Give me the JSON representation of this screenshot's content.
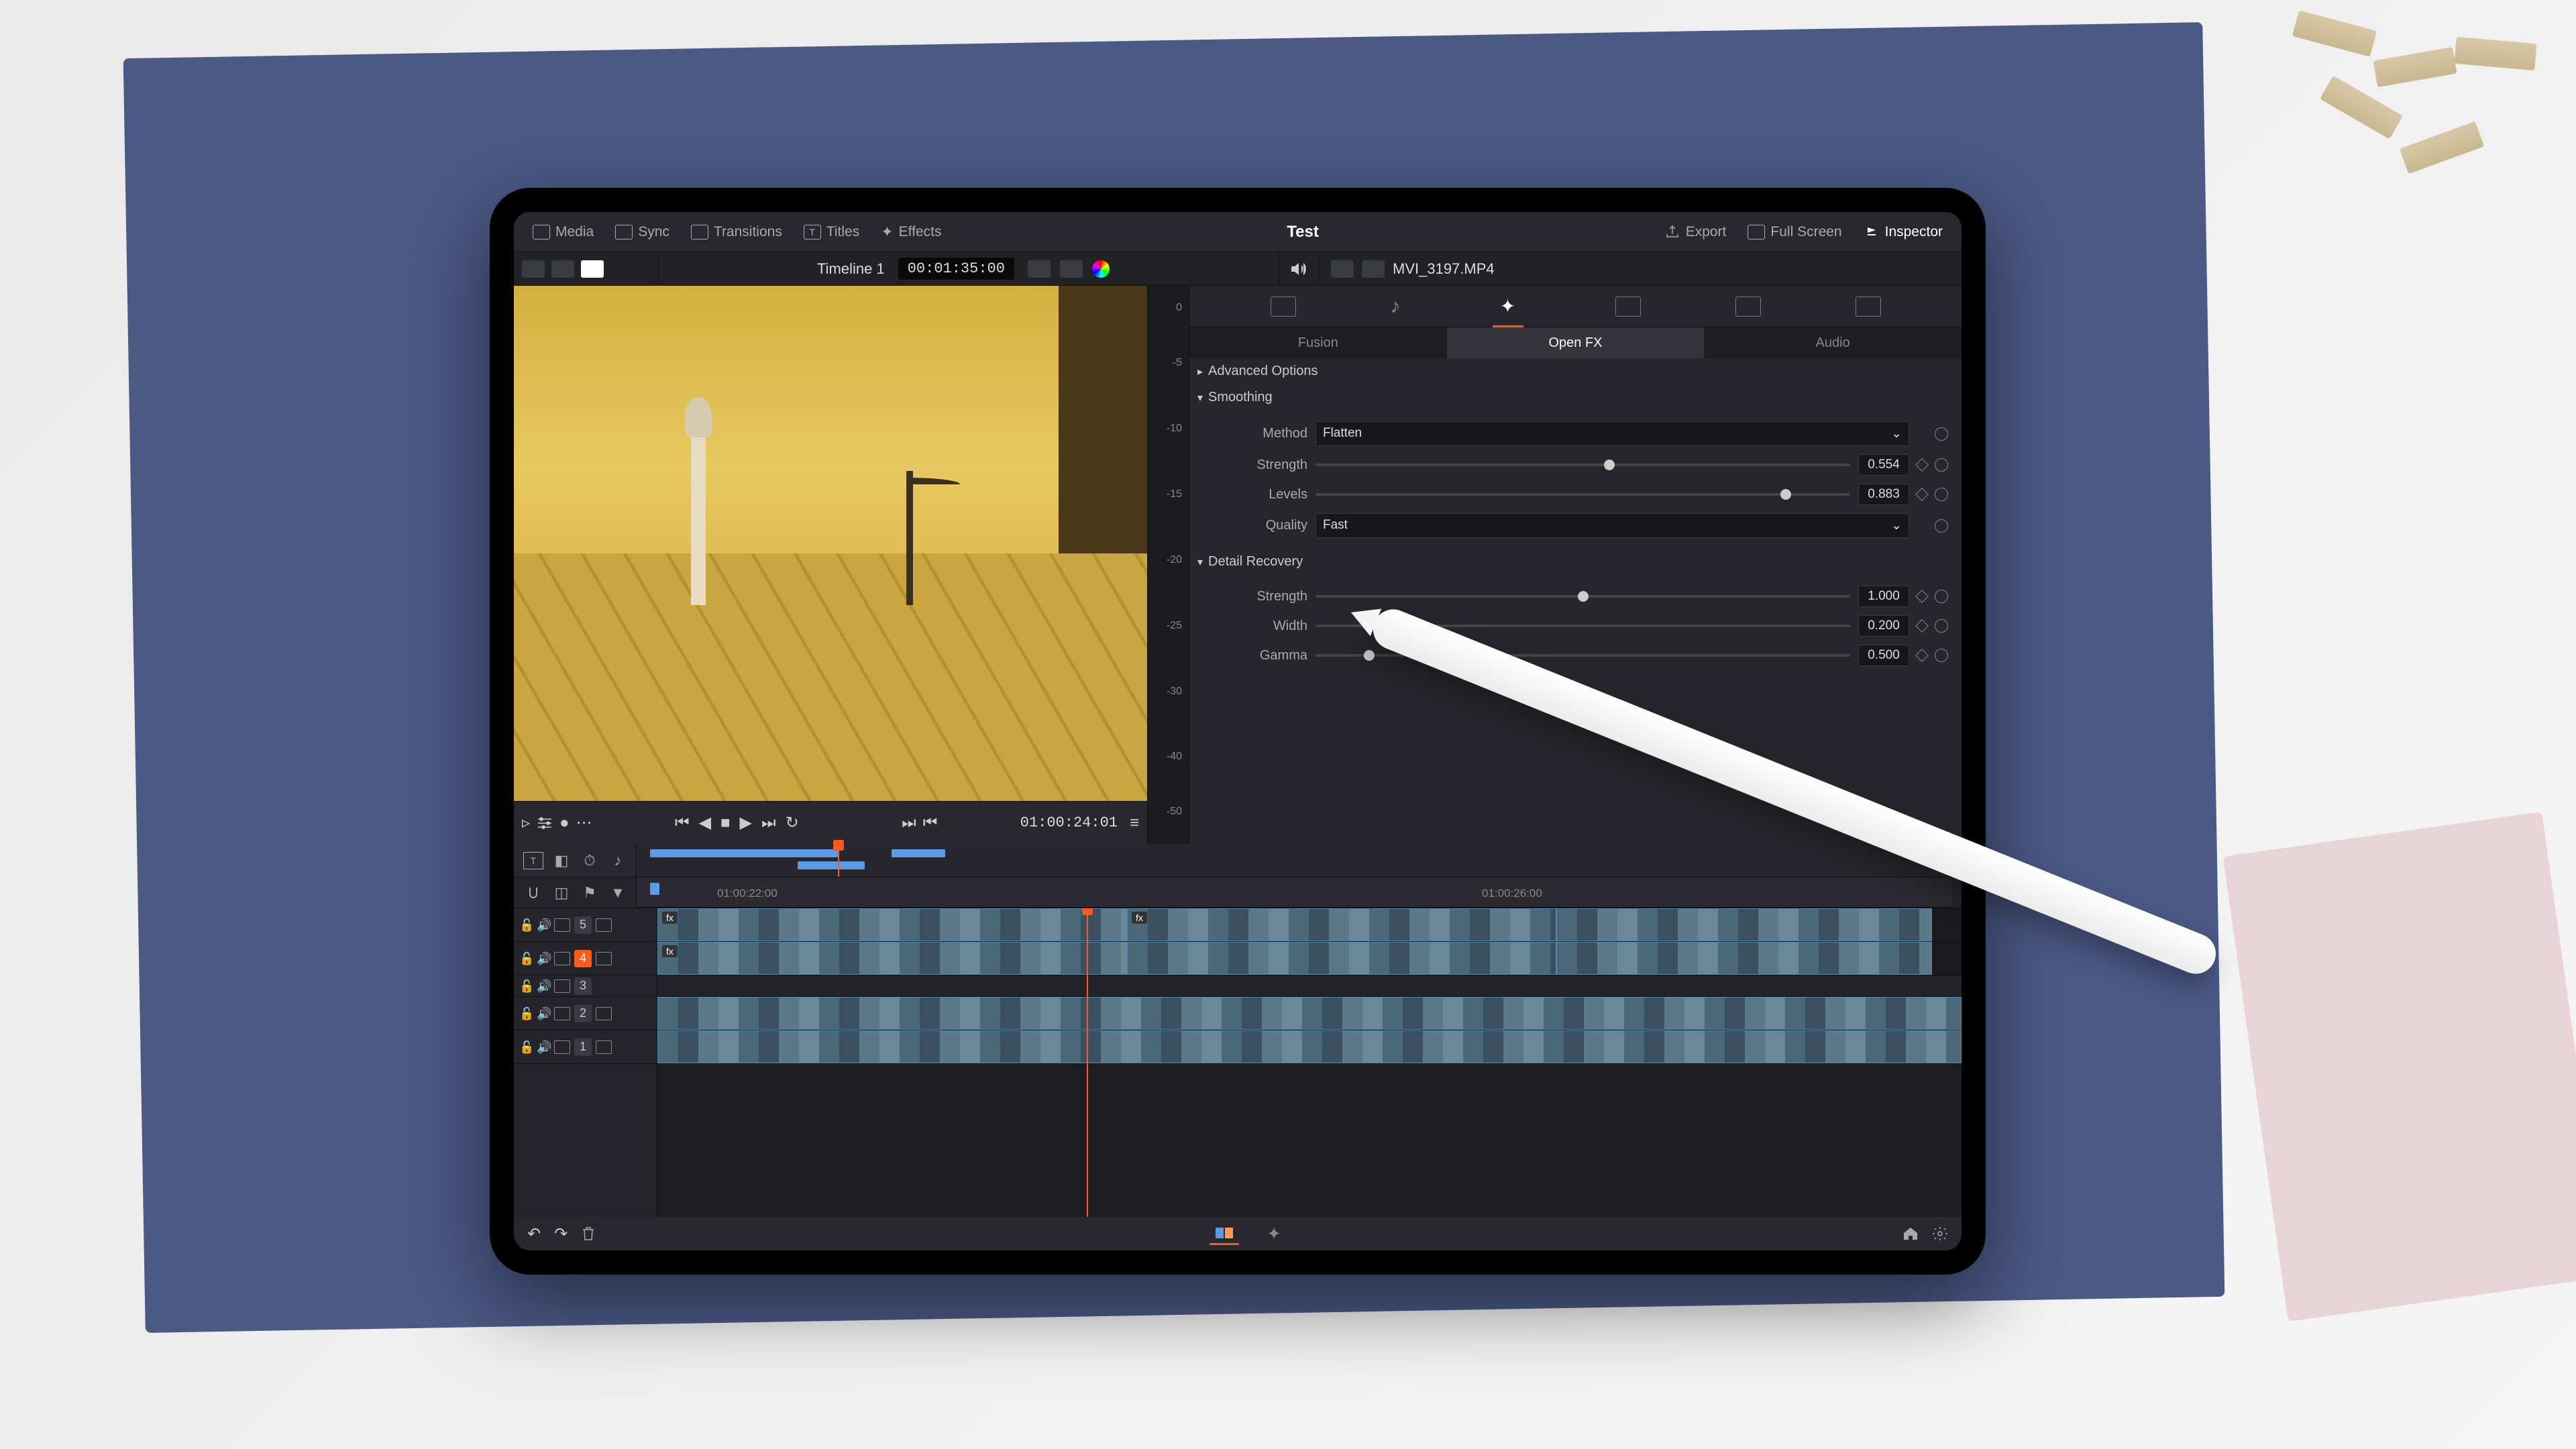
{
  "toolbar": {
    "media": "Media",
    "sync": "Sync",
    "transitions": "Transitions",
    "titles": "Titles",
    "effects": "Effects",
    "export": "Export",
    "fullscreen": "Full Screen",
    "inspector": "Inspector"
  },
  "project_title": "Test",
  "timeline": {
    "name": "Timeline 1",
    "timecode": "00:01:35:00"
  },
  "clip": {
    "name": "MVI_3197.MP4"
  },
  "transport": {
    "timecode": "01:00:24:01"
  },
  "audio_meter": {
    "ticks": [
      "0",
      "-5",
      "-10",
      "-15",
      "-20",
      "-25",
      "-30",
      "-40",
      "-50"
    ]
  },
  "inspector_panel": {
    "subtabs": {
      "fusion": "Fusion",
      "openfx": "Open FX",
      "audio": "Audio"
    },
    "sections": {
      "advanced": "Advanced Options",
      "smoothing": {
        "title": "Smoothing",
        "method_label": "Method",
        "method_value": "Flatten",
        "strength_label": "Strength",
        "strength_value": "0.554",
        "levels_label": "Levels",
        "levels_value": "0.883",
        "quality_label": "Quality",
        "quality_value": "Fast"
      },
      "detail": {
        "title": "Detail Recovery",
        "strength_label": "Strength",
        "strength_value": "1.000",
        "width_label": "Width",
        "width_value": "0.200",
        "gamma_label": "Gamma",
        "gamma_value": "0.500"
      }
    }
  },
  "tl_ruler": {
    "ticks": [
      "01:00:22:00",
      "01:00:26:00"
    ]
  },
  "tracks": {
    "nums": [
      "5",
      "4",
      "3",
      "2",
      "1"
    ]
  }
}
